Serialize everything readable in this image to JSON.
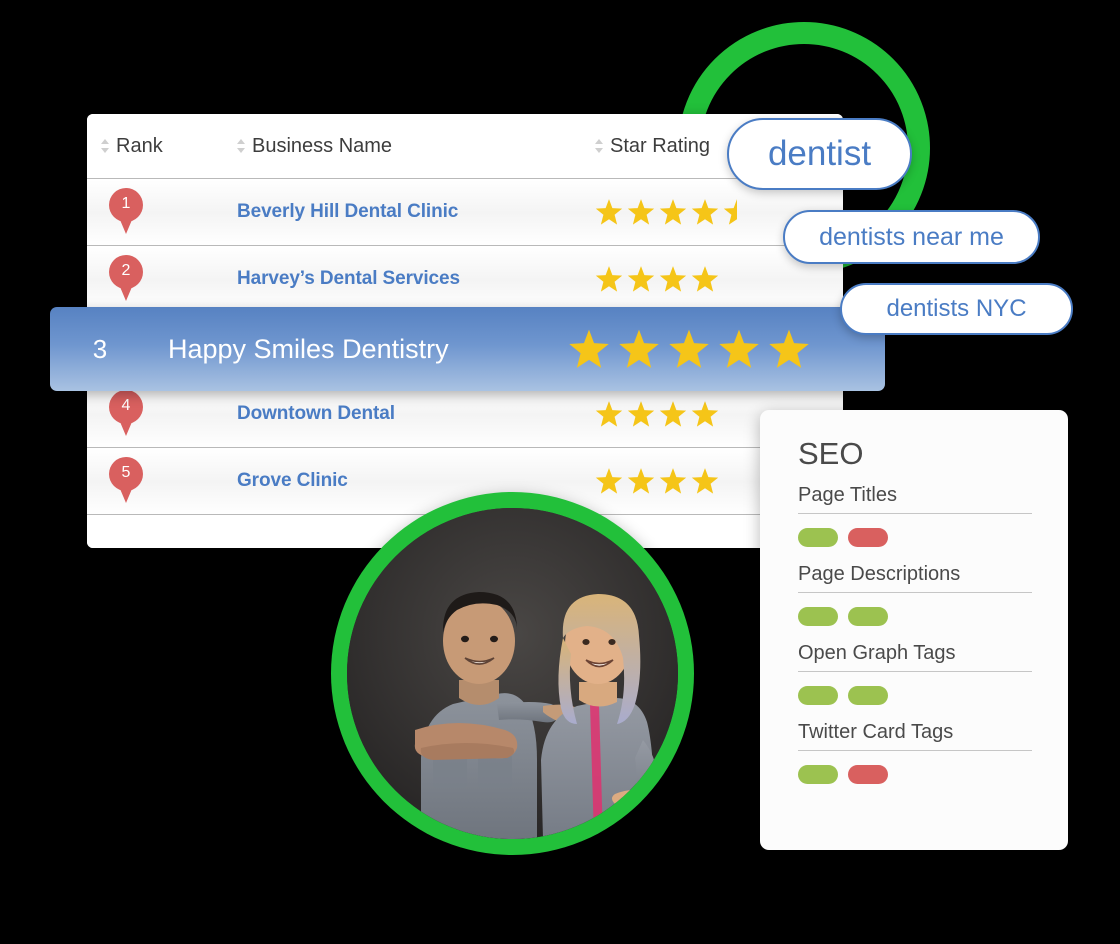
{
  "theme": {
    "accent_blue": "#4a7cc4",
    "accent_green": "#22c03a",
    "star_yellow": "#f5c518",
    "pin_red": "#d9605f",
    "pill_green": "#9cc250",
    "pill_red": "#d9605f",
    "background": "#000000"
  },
  "rank_table": {
    "columns": [
      {
        "label": "Rank",
        "sort_icon": "sort-arrows-icon"
      },
      {
        "label": "Business Name",
        "sort_icon": "sort-arrows-icon"
      },
      {
        "label": "Star Rating",
        "sort_icon": "sort-arrows-icon"
      }
    ],
    "rows": [
      {
        "rank": "1",
        "name": "Beverly Hill Dental Clinic",
        "stars": 4.5,
        "highlighted": false
      },
      {
        "rank": "2",
        "name": "Harvey’s Dental Services",
        "stars": 4,
        "highlighted": false
      },
      {
        "rank": "3",
        "name": "Happy Smiles Dentistry",
        "stars": 5,
        "highlighted": true
      },
      {
        "rank": "4",
        "name": "Downtown Dental",
        "stars": 4,
        "highlighted": false
      },
      {
        "rank": "5",
        "name": "Grove Clinic",
        "stars": 4,
        "highlighted": false
      }
    ]
  },
  "search_suggestions": [
    {
      "text": "dentist"
    },
    {
      "text": "dentists near me"
    },
    {
      "text": "dentists NYC"
    }
  ],
  "seo_panel": {
    "title": "SEO",
    "groups": [
      {
        "label": "Page Titles",
        "statuses": [
          "green",
          "red"
        ]
      },
      {
        "label": "Page Descriptions",
        "statuses": [
          "green",
          "green"
        ]
      },
      {
        "label": "Open Graph Tags",
        "statuses": [
          "green",
          "green"
        ]
      },
      {
        "label": "Twitter Card Tags",
        "statuses": [
          "green",
          "red"
        ]
      }
    ]
  },
  "photo": {
    "alt": "Two dental professionals in grey scrubs smiling",
    "ring_color": "#22c03a"
  }
}
